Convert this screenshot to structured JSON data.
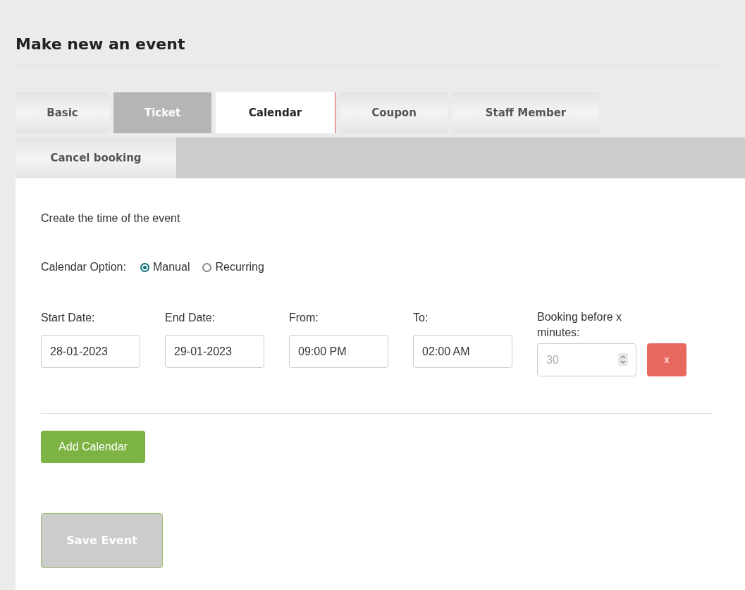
{
  "title": "Make new an event",
  "tabs": [
    {
      "label": "Basic",
      "selected": false,
      "disabled": false
    },
    {
      "label": "Ticket",
      "selected": false,
      "disabled": true
    },
    {
      "label": "Calendar",
      "selected": true,
      "disabled": false
    },
    {
      "label": "Coupon",
      "selected": false,
      "disabled": false
    },
    {
      "label": "Staff Member",
      "selected": false,
      "disabled": false
    },
    {
      "label": "Cancel booking",
      "selected": false,
      "disabled": false
    }
  ],
  "intro": "Create the time of the event",
  "calendar_option": {
    "label": "Calendar Option:",
    "options": [
      {
        "label": "Manual",
        "selected": true
      },
      {
        "label": "Recurring",
        "selected": false
      }
    ]
  },
  "fields": [
    {
      "label": "Start Date:",
      "value": "28-01-2023"
    },
    {
      "label": "End Date:",
      "value": "29-01-2023"
    },
    {
      "label": "From:",
      "value": "09:00 PM"
    },
    {
      "label": "To:",
      "value": "02:00 AM"
    }
  ],
  "booking": {
    "label": "Booking before x minutes:",
    "placeholder": "30"
  },
  "remove_button": "x",
  "add_button": "Add Calendar",
  "save_button": {
    "label": "Save Event",
    "disabled": true
  }
}
